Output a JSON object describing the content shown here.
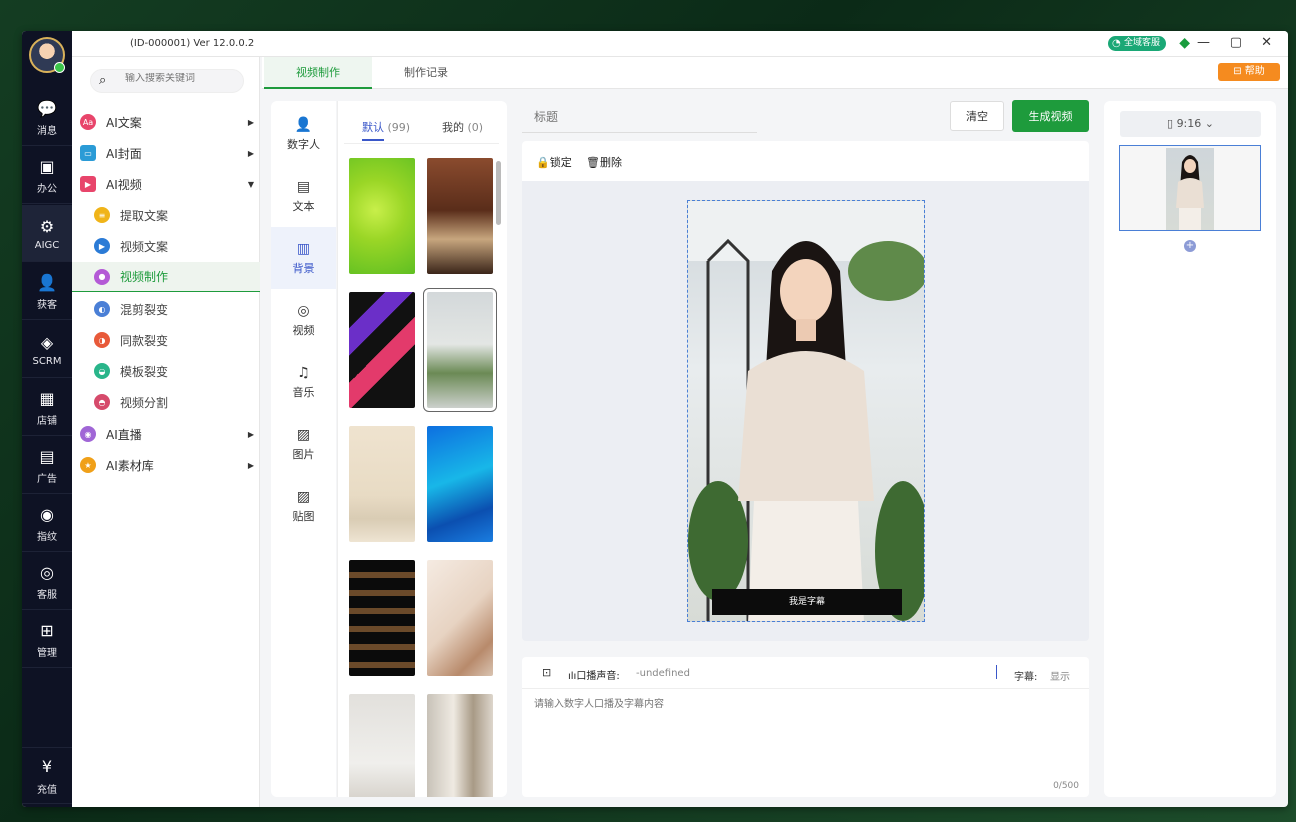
{
  "titlebar": {
    "version": "(ID-000001)  Ver 12.0.0.2",
    "service": "全域客服",
    "minimize": "—",
    "maximize": "▢",
    "close": "✕"
  },
  "rail": {
    "items": [
      {
        "label": "消息",
        "icon": "message-icon"
      },
      {
        "label": "办公",
        "icon": "office-icon"
      },
      {
        "label": "AIGC",
        "icon": "aigc-icon"
      },
      {
        "label": "获客",
        "icon": "user-add-icon"
      },
      {
        "label": "SCRM",
        "icon": "scrm-icon"
      },
      {
        "label": "店铺",
        "icon": "shop-icon"
      },
      {
        "label": "广告",
        "icon": "ads-icon"
      },
      {
        "label": "指纹",
        "icon": "fingerprint-icon"
      },
      {
        "label": "客服",
        "icon": "support-icon"
      },
      {
        "label": "管理",
        "icon": "grid-icon"
      }
    ],
    "bottom": {
      "label": "充值",
      "icon": "recharge-icon"
    }
  },
  "search": {
    "placeholder": "输入搜索关键词"
  },
  "menu": {
    "items": [
      {
        "label": "AI文案",
        "color": "#e8456b"
      },
      {
        "label": "AI封面",
        "color": "#2b9bd6"
      },
      {
        "label": "AI视频",
        "color": "#e8456b"
      },
      {
        "label": "提取文案",
        "color": "#f0b419"
      },
      {
        "label": "视频文案",
        "color": "#2b7bd6"
      },
      {
        "label": "视频制作",
        "color": "#b45ad6"
      },
      {
        "label": "混剪裂变",
        "color": "#4a7fd6"
      },
      {
        "label": "同款裂变",
        "color": "#e85a3a"
      },
      {
        "label": "模板裂变",
        "color": "#29b58a"
      },
      {
        "label": "视频分割",
        "color": "#d64a6b"
      },
      {
        "label": "AI直播",
        "color": "#a066d6"
      },
      {
        "label": "AI素材库",
        "color": "#f0a019"
      }
    ]
  },
  "tabs": {
    "make": "视频制作",
    "records": "制作记录",
    "help": "帮助"
  },
  "categories": [
    "数字人",
    "文本",
    "背景",
    "视频",
    "音乐",
    "图片",
    "贴图"
  ],
  "subtabs": {
    "default": "默认",
    "default_count": "(99)",
    "mine": "我的",
    "mine_count": "(0)"
  },
  "editor": {
    "title_placeholder": "标题",
    "clear": "清空",
    "generate": "生成视频",
    "lock": "锁定",
    "delete": "删除",
    "caption": "我是字幕"
  },
  "script": {
    "voice_label": "口播声音:",
    "voice_value": "-undefined",
    "subtitle_label": "字幕:",
    "subtitle_value": "显示",
    "placeholder": "请输入数字人口播及字幕内容",
    "count": "0/500"
  },
  "preview": {
    "ratio": "9:16"
  }
}
